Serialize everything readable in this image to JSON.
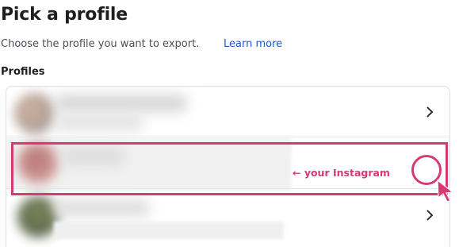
{
  "header": {
    "title": "Pick a profile",
    "subtitle": "Choose the profile you want to export.",
    "learn_more": "Learn more"
  },
  "profiles": {
    "section_label": "Profiles",
    "items": [
      {
        "avatar_color": "#b89a86",
        "chevron": "chevron-right-icon"
      },
      {
        "avatar_color": "#a75a5c",
        "chevron": "chevron-right-icon"
      },
      {
        "avatar_color": "#5c6a3c",
        "chevron": "chevron-right-icon"
      }
    ]
  },
  "annotation": {
    "label": "← your Instagram",
    "color": "#d63a74"
  }
}
